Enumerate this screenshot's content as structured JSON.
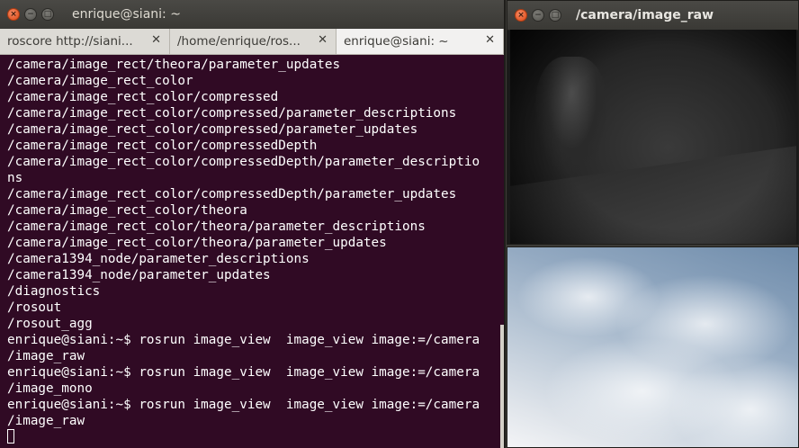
{
  "terminal_window": {
    "title": "enrique@siani: ~",
    "tabs": [
      {
        "label": "roscore http://siani..."
      },
      {
        "label": "/home/enrique/ros..."
      },
      {
        "label": "enrique@siani: ~"
      }
    ],
    "lines": [
      "/camera/image_rect/theora/parameter_updates",
      "/camera/image_rect_color",
      "/camera/image_rect_color/compressed",
      "/camera/image_rect_color/compressed/parameter_descriptions",
      "/camera/image_rect_color/compressed/parameter_updates",
      "/camera/image_rect_color/compressedDepth",
      "/camera/image_rect_color/compressedDepth/parameter_descriptio",
      "ns",
      "/camera/image_rect_color/compressedDepth/parameter_updates",
      "/camera/image_rect_color/theora",
      "/camera/image_rect_color/theora/parameter_descriptions",
      "/camera/image_rect_color/theora/parameter_updates",
      "/camera1394_node/parameter_descriptions",
      "/camera1394_node/parameter_updates",
      "/diagnostics",
      "/rosout",
      "/rosout_agg",
      "enrique@siani:~$ rosrun image_view  image_view image:=/camera",
      "/image_raw",
      "enrique@siani:~$ rosrun image_view  image_view image:=/camera",
      "/image_mono",
      "enrique@siani:~$ rosrun image_view  image_view image:=/camera",
      "/image_raw"
    ]
  },
  "image_window": {
    "title": "/camera/image_raw"
  },
  "icons": {
    "close": "×",
    "minimize": "−",
    "maximize": "□",
    "tab_close": "✕"
  },
  "colors": {
    "terminal_bg": "#300a24",
    "terminal_fg": "#ffffff",
    "titlebar": "#3c3b37",
    "close_button": "#dd4814"
  }
}
